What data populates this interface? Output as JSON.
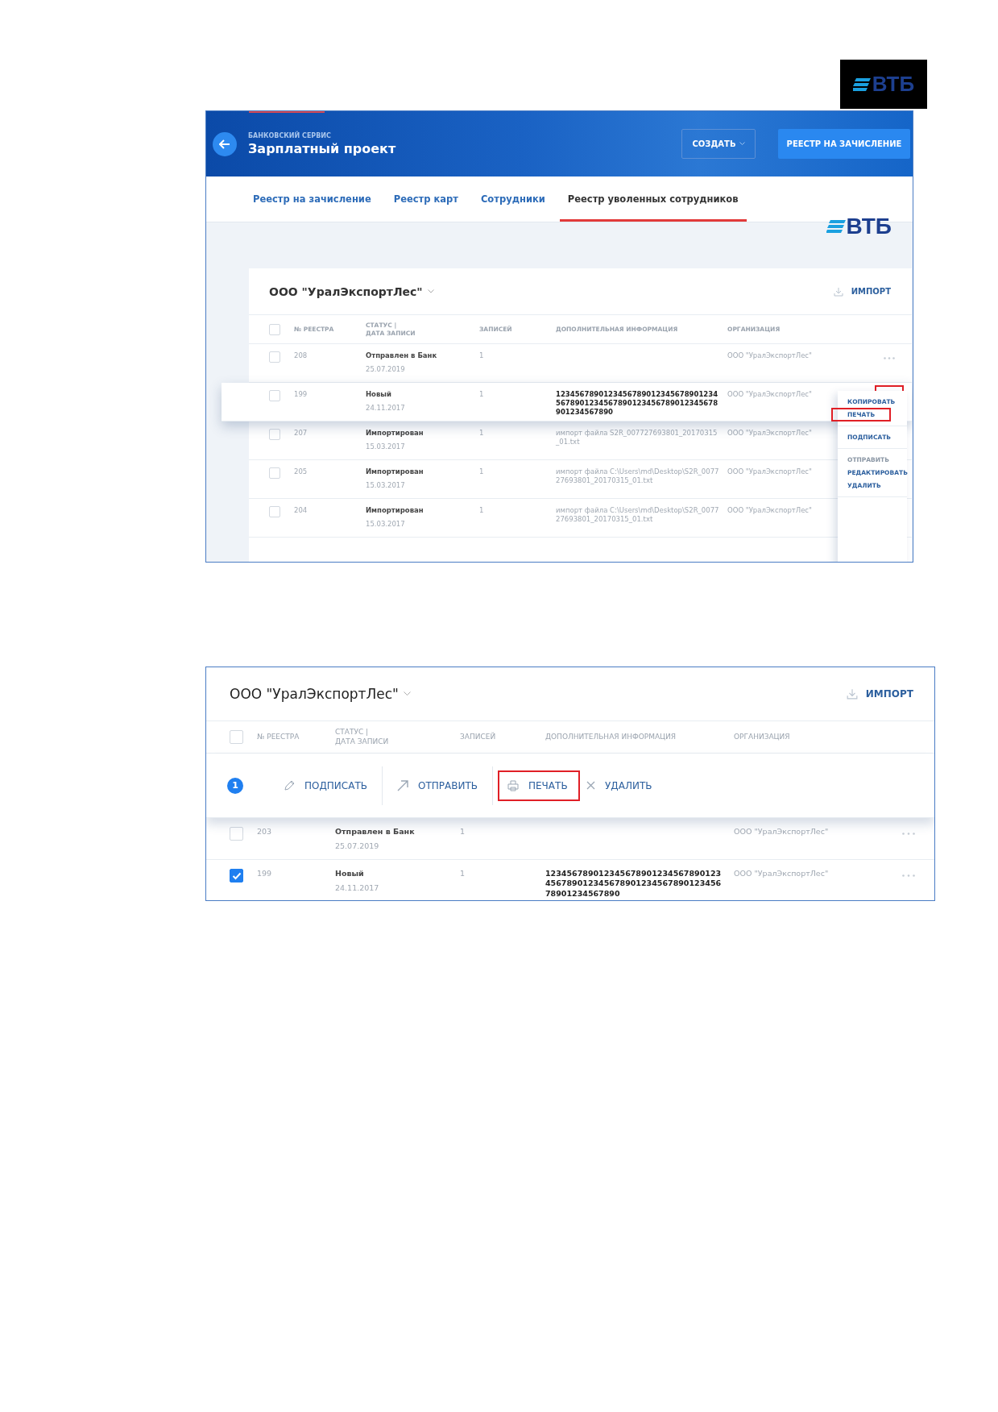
{
  "page_logo": {
    "text": "ВТБ"
  },
  "screen_1": {
    "header": {
      "subtitle": "БАНКОВСКИЙ СЕРВИС",
      "title": "Зарплатный проект",
      "buttons": [
        {
          "label": "СОЗДАТЬ",
          "kind": "outline"
        },
        {
          "label": "РЕЕСТР НА ЗАЧИСЛЕНИЕ",
          "kind": "primary"
        }
      ]
    },
    "tabs": [
      {
        "label": "Реестр на зачисление",
        "selected": false
      },
      {
        "label": "Реестр карт",
        "selected": false
      },
      {
        "label": "Сотрудники",
        "selected": false
      },
      {
        "label": "Реестр уволенных сотрудников",
        "selected": true
      }
    ],
    "logo": {
      "text": "ВТБ"
    },
    "company": "ООО \"УралЭкспортЛес\"",
    "import_label": "ИМПОРТ",
    "all_checked": false,
    "columns": [
      "№ РЕЕСТРА",
      "СТАТУС |\nДАТА ЗАПИСИ",
      "ЗАПИСЕЙ",
      "ДОПОЛНИТЕЛЬНАЯ ИНФОРМАЦИЯ",
      "ОРГАНИЗАЦИЯ"
    ],
    "rows": [
      {
        "checked": false,
        "number": "208",
        "status": "Отправлен в Банк",
        "date": "25.07.2019",
        "records": "1",
        "organization": "ООО \"УралЭкспортЛес\"",
        "active": false,
        "actions_highlighted": false
      },
      {
        "checked": false,
        "number": "199",
        "status": "Новый",
        "date": "24.11.2017",
        "records": "1",
        "info": "12345678901234567890123456789012345678901234567890123456789012345678901234567890",
        "info_emphasis": true,
        "organization": "ООО \"УралЭкспортЛес\"",
        "active": true,
        "actions_highlighted": true
      },
      {
        "checked": false,
        "number": "207",
        "status": "Импортирован",
        "date": "15.03.2017",
        "records": "1",
        "info": "импорт файла S2R_007727693801_20170315_01.txt",
        "info_emphasis": false,
        "organization": "ООО \"УралЭкспортЛес\"",
        "active": false,
        "actions_highlighted": false
      },
      {
        "checked": false,
        "number": "205",
        "status": "Импортирован",
        "date": "15.03.2017",
        "records": "1",
        "info": "импорт файла C:\\Users\\md\\Desktop\\S2R_007727693801_20170315_01.txt",
        "info_emphasis": false,
        "organization": "ООО \"УралЭкспортЛес\"",
        "active": false,
        "actions_highlighted": false
      },
      {
        "checked": false,
        "number": "204",
        "status": "Импортирован",
        "date": "15.03.2017",
        "records": "1",
        "info": "импорт файла C:\\Users\\md\\Desktop\\S2R_007727693801_20170315_01.txt",
        "info_emphasis": false,
        "organization": "ООО \"УралЭкспортЛес\"",
        "active": false,
        "actions_highlighted": false
      }
    ],
    "menu": {
      "groups": [
        [
          {
            "label": "КОПИРОВАТЬ",
            "disabled": false,
            "highlighted": false
          },
          {
            "label": "ПЕЧАТЬ",
            "disabled": false,
            "highlighted": true
          }
        ],
        [
          {
            "label": "ПОДПИСАТЬ",
            "disabled": false,
            "highlighted": false
          }
        ],
        [
          {
            "label": "ОТПРАВИТЬ",
            "disabled": true,
            "highlighted": false
          },
          {
            "label": "РЕДАКТИРОВАТЬ",
            "disabled": false,
            "highlighted": false
          },
          {
            "label": "УДАЛИТЬ",
            "disabled": false,
            "highlighted": false
          }
        ]
      ]
    }
  },
  "screen_2": {
    "company": "ООО \"УралЭкспортЛес\"",
    "import_label": "ИМПОРТ",
    "all_checked": false,
    "columns": [
      "№ РЕЕСТРА",
      "СТАТУС |\nДАТА ЗАПИСИ",
      "ЗАПИСЕЙ",
      "ДОПОЛНИТЕЛЬНАЯ ИНФОРМАЦИЯ",
      "ОРГАНИЗАЦИЯ"
    ],
    "selection_bar": {
      "count": "1",
      "actions": [
        {
          "label": "ПОДПИСАТЬ",
          "kind": "pen",
          "highlighted": false
        },
        {
          "label": "ОТПРАВИТЬ",
          "kind": "arrow",
          "highlighted": false
        },
        {
          "label": "ПЕЧАТЬ",
          "kind": "printer",
          "highlighted": true
        },
        {
          "label": "УДАЛИТЬ",
          "kind": "close",
          "highlighted": false
        }
      ]
    },
    "rows": [
      {
        "checked": false,
        "number": "203",
        "status": "Отправлен в Банк",
        "date": "25.07.2019",
        "records": "1",
        "organization": "ООО \"УралЭкспортЛес\""
      },
      {
        "checked": true,
        "number": "199",
        "status": "Новый",
        "date": "24.11.2017",
        "records": "1",
        "info": "12345678901234567890123456789012345678901234567890123456789012345678901234567890",
        "info_emphasis": true,
        "organization": "ООО \"УралЭкспортЛес\""
      }
    ]
  }
}
